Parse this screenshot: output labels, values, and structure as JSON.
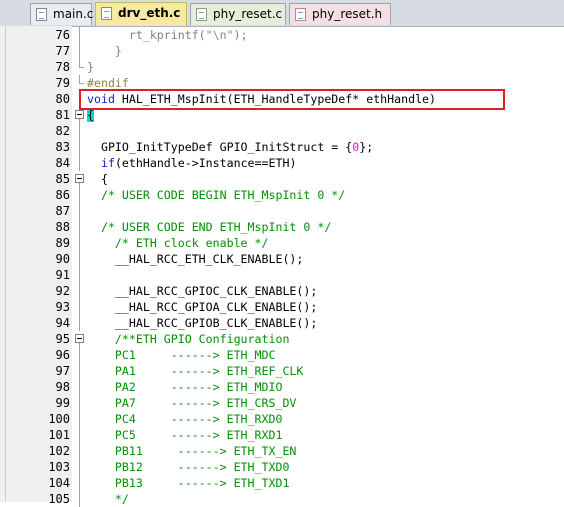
{
  "tabs": [
    {
      "label": "main.c",
      "icon": "c-file-icon",
      "active": false
    },
    {
      "label": "drv_eth.c",
      "icon": "c-file-icon",
      "active": true
    },
    {
      "label": "phy_reset.c",
      "icon": "c-file-icon",
      "active": false
    },
    {
      "label": "phy_reset.h",
      "icon": "h-file-icon",
      "active": false
    }
  ],
  "colors": {
    "keyword": "#1818d8",
    "comment": "#009000",
    "number": "#ff00ff",
    "string": "#888888",
    "highlight_box": "#e02020",
    "brace_match": "#00d8d8"
  },
  "highlighted_line": "80",
  "lines": [
    {
      "n": "76",
      "fold": "line",
      "segs": [
        {
          "t": "      rt_kprintf(",
          "c": "muted"
        },
        {
          "t": "\"\\n\"",
          "c": "str"
        },
        {
          "t": ");",
          "c": "muted"
        }
      ]
    },
    {
      "n": "77",
      "fold": "line",
      "segs": [
        {
          "t": "    }",
          "c": "muted"
        }
      ]
    },
    {
      "n": "78",
      "fold": "end",
      "segs": [
        {
          "t": "}",
          "c": "muted"
        }
      ]
    },
    {
      "n": "79",
      "fold": "end",
      "segs": [
        {
          "t": "#endif",
          "c": "pp"
        }
      ]
    },
    {
      "n": "80",
      "fold": "",
      "segs": [
        {
          "t": "void",
          "c": "kw"
        },
        {
          "t": " HAL_ETH_MspInit(ETH_HandleTypeDef* ethHandle)",
          "c": ""
        }
      ]
    },
    {
      "n": "81",
      "fold": "box",
      "segs": [
        {
          "t": "{",
          "c": "bracehl"
        }
      ]
    },
    {
      "n": "82",
      "fold": "line",
      "segs": []
    },
    {
      "n": "83",
      "fold": "line",
      "segs": [
        {
          "t": "  GPIO_InitTypeDef GPIO_InitStruct = {",
          "c": ""
        },
        {
          "t": "0",
          "c": "num"
        },
        {
          "t": "};",
          "c": ""
        }
      ]
    },
    {
      "n": "84",
      "fold": "line",
      "segs": [
        {
          "t": "  ",
          "c": ""
        },
        {
          "t": "if",
          "c": "kw"
        },
        {
          "t": "(ethHandle->Instance==ETH)",
          "c": ""
        }
      ]
    },
    {
      "n": "85",
      "fold": "box",
      "segs": [
        {
          "t": "  {",
          "c": ""
        }
      ]
    },
    {
      "n": "86",
      "fold": "line",
      "segs": [
        {
          "t": "  /* USER CODE BEGIN ETH_MspInit 0 */",
          "c": "cm"
        }
      ]
    },
    {
      "n": "87",
      "fold": "line",
      "segs": []
    },
    {
      "n": "88",
      "fold": "line",
      "segs": [
        {
          "t": "  /* USER CODE END ETH_MspInit 0 */",
          "c": "cm"
        }
      ]
    },
    {
      "n": "89",
      "fold": "line",
      "segs": [
        {
          "t": "    /* ETH clock enable */",
          "c": "cm"
        }
      ]
    },
    {
      "n": "90",
      "fold": "line",
      "segs": [
        {
          "t": "    __HAL_RCC_ETH_CLK_ENABLE();",
          "c": ""
        }
      ]
    },
    {
      "n": "91",
      "fold": "line",
      "segs": []
    },
    {
      "n": "92",
      "fold": "line",
      "segs": [
        {
          "t": "    __HAL_RCC_GPIOC_CLK_ENABLE();",
          "c": ""
        }
      ]
    },
    {
      "n": "93",
      "fold": "line",
      "segs": [
        {
          "t": "    __HAL_RCC_GPIOA_CLK_ENABLE();",
          "c": ""
        }
      ]
    },
    {
      "n": "94",
      "fold": "line",
      "segs": [
        {
          "t": "    __HAL_RCC_GPIOB_CLK_ENABLE();",
          "c": ""
        }
      ]
    },
    {
      "n": "95",
      "fold": "box",
      "segs": [
        {
          "t": "    /**ETH GPIO Configuration",
          "c": "cm"
        }
      ]
    },
    {
      "n": "96",
      "fold": "line",
      "segs": [
        {
          "t": "    PC1     ------> ETH_MDC",
          "c": "cm"
        }
      ]
    },
    {
      "n": "97",
      "fold": "line",
      "segs": [
        {
          "t": "    PA1     ------> ETH_REF_CLK",
          "c": "cm"
        }
      ]
    },
    {
      "n": "98",
      "fold": "line",
      "segs": [
        {
          "t": "    PA2     ------> ETH_MDIO",
          "c": "cm"
        }
      ]
    },
    {
      "n": "99",
      "fold": "line",
      "segs": [
        {
          "t": "    PA7     ------> ETH_CRS_DV",
          "c": "cm"
        }
      ]
    },
    {
      "n": "100",
      "fold": "line",
      "segs": [
        {
          "t": "    PC4     ------> ETH_RXD0",
          "c": "cm"
        }
      ]
    },
    {
      "n": "101",
      "fold": "line",
      "segs": [
        {
          "t": "    PC5     ------> ETH_RXD1",
          "c": "cm"
        }
      ]
    },
    {
      "n": "102",
      "fold": "line",
      "segs": [
        {
          "t": "    PB11     ------> ETH_TX_EN",
          "c": "cm"
        }
      ]
    },
    {
      "n": "103",
      "fold": "line",
      "segs": [
        {
          "t": "    PB12     ------> ETH_TXD0",
          "c": "cm"
        }
      ]
    },
    {
      "n": "104",
      "fold": "line",
      "segs": [
        {
          "t": "    PB13     ------> ETH_TXD1",
          "c": "cm"
        }
      ]
    },
    {
      "n": "105",
      "fold": "line",
      "segs": [
        {
          "t": "    */",
          "c": "cm"
        }
      ]
    }
  ]
}
